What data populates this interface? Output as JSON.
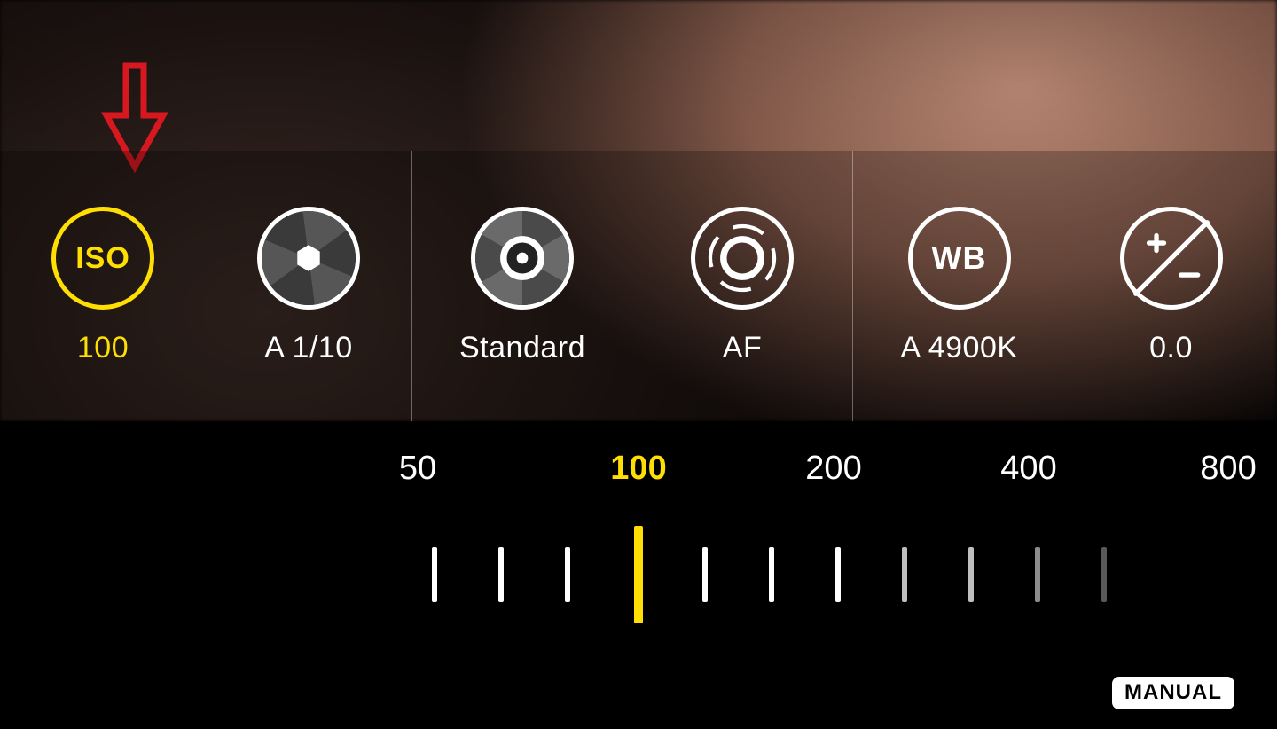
{
  "colors": {
    "accent": "#ffde03",
    "foreground": "#ffffff"
  },
  "controls": [
    {
      "id": "iso",
      "icon_text": "ISO",
      "value_label": "100",
      "active": true
    },
    {
      "id": "shutter",
      "value_label": "A 1/10",
      "active": false
    },
    {
      "id": "metering",
      "value_label": "Standard",
      "active": false
    },
    {
      "id": "focus",
      "value_label": "AF",
      "active": false
    },
    {
      "id": "wb",
      "icon_text": "WB",
      "value_label": "A 4900K",
      "active": false
    },
    {
      "id": "ev",
      "value_label": "0.0",
      "active": false
    }
  ],
  "iso_slider": {
    "selected": "100",
    "labels": [
      "50",
      "100",
      "200",
      "400",
      "800"
    ]
  },
  "mode_button": "MANUAL"
}
